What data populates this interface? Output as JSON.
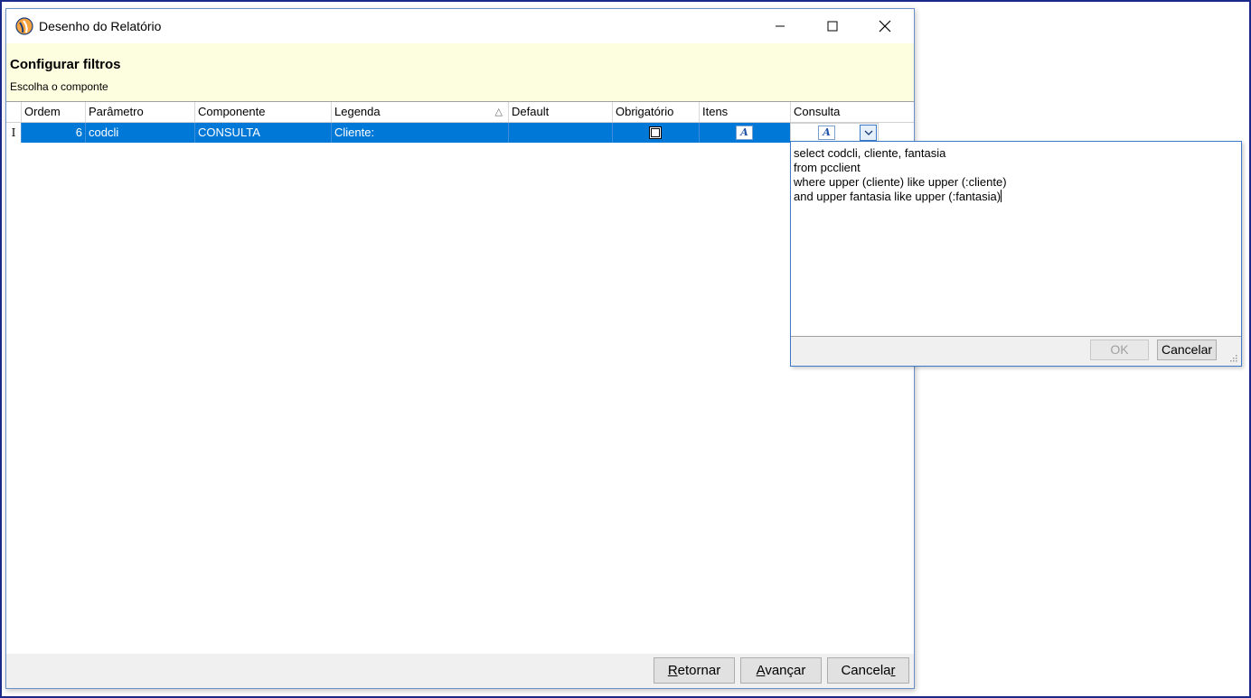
{
  "window": {
    "title": "Desenho do Relatório"
  },
  "header": {
    "title": "Configurar filtros",
    "subtitle": "Escolha o componte"
  },
  "grid": {
    "columns": [
      "Ordem",
      "Parâmetro",
      "Componente",
      "Legenda",
      "Default",
      "Obrigatório",
      "Itens",
      "Consulta"
    ],
    "sort_column": "Legenda",
    "rows": [
      {
        "indicator": "I",
        "ordem": "6",
        "parametro": "codcli",
        "componente": "CONSULTA",
        "legenda": "Cliente:",
        "default": "",
        "obrigatorio": "checked",
        "itens_icon": "A",
        "consulta_icon": "A"
      }
    ]
  },
  "footer": {
    "retornar_pre": "",
    "retornar_u": "R",
    "retornar_post": "etornar",
    "avancar_pre": "",
    "avancar_u": "A",
    "avancar_post": "vançar",
    "cancelar_pre": "Cancela",
    "cancelar_u": "r",
    "cancelar_post": ""
  },
  "popup": {
    "lines": [
      "select codcli, cliente, fantasia",
      "from pcclient",
      "where upper (cliente) like upper (:cliente)",
      "and upper fantasia like upper (:fantasia)"
    ],
    "ok_label": "OK",
    "cancel_label": "Cancelar"
  },
  "colors": {
    "selection": "#0078d7",
    "header_band": "#fdfde0",
    "border_accent": "#3a7ac8"
  }
}
